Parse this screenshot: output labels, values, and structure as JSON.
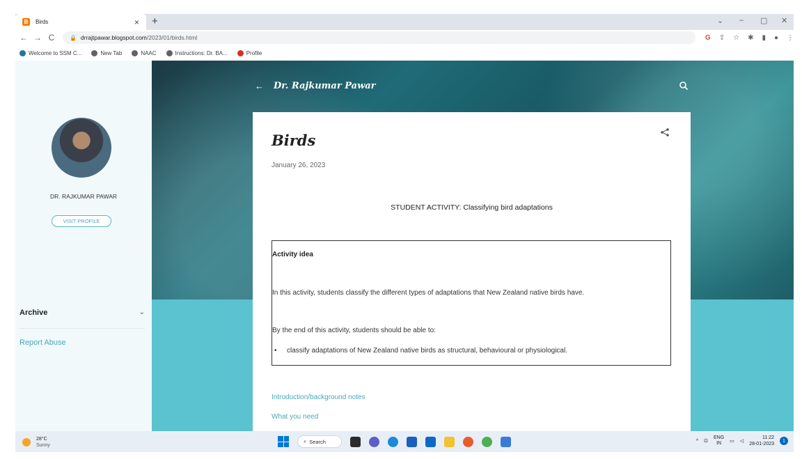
{
  "browser": {
    "tab_title": "Birds",
    "tab_favicon": "B",
    "tab_close": "×",
    "new_tab": "+",
    "url_host": "drrajtpawar.blogspot.com",
    "url_path": "/2023/01/birds.html",
    "minimize": "⌄",
    "restore": "–",
    "maximize": "▢",
    "close": "✕",
    "bookmarks": [
      "Welcome to SSM C...",
      "New Tab",
      "NAAC",
      "Instructions: Dr. BA...",
      "Profile"
    ]
  },
  "sidebar": {
    "profile_name": "DR. RAJKUMAR PAWAR",
    "visit_profile": "VISIT PROFILE",
    "archive_label": "Archive",
    "report_abuse": "Report Abuse"
  },
  "blog": {
    "title": "Dr. Rajkumar Pawar"
  },
  "post": {
    "title": "Birds",
    "date": "January 26, 2023",
    "activity_heading": "STUDENT ACTIVITY: Classifying bird adaptations",
    "box_title": "Activity idea",
    "box_paragraph_1": "In this activity, students classify the different types of adaptations that New Zealand native birds have.",
    "box_paragraph_2": "By the end of this activity, students should be able to:",
    "box_bullet_1": "classify adaptations of New Zealand native birds as structural, behavioural or physiological.",
    "link_1": "Introduction/background notes",
    "link_2": "What you need"
  },
  "taskbar": {
    "temperature": "28°C",
    "weather": "Sunny",
    "search": "Search",
    "lang_1": "ENG",
    "lang_2": "IN",
    "time": "11:22",
    "date": "28-01-2023",
    "notifications": "1"
  },
  "colors": {
    "accent": "#4aa7b8",
    "teal_band": "#5bc2d0",
    "sidebar_bg": "#f2f9fb"
  }
}
